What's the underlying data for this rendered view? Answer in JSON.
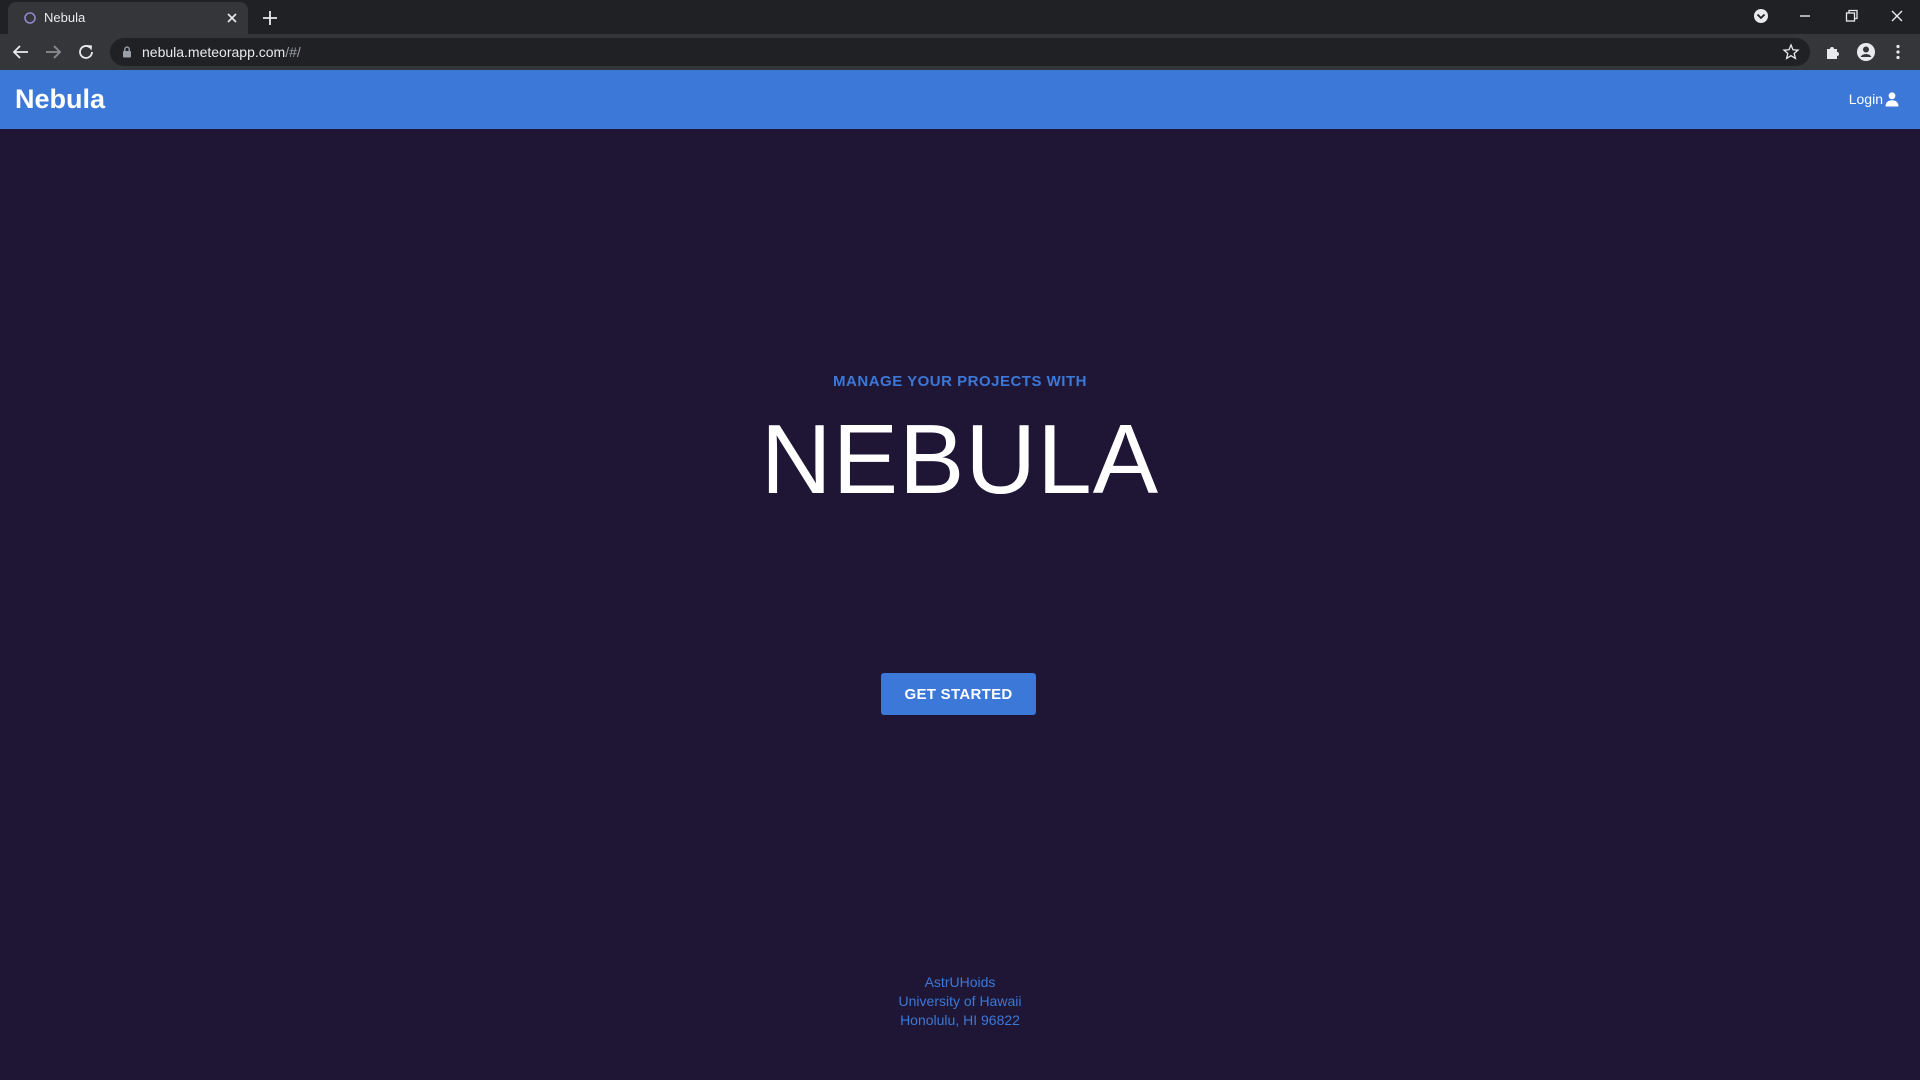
{
  "browser": {
    "tab_title": "Nebula",
    "url_host": "nebula.meteorapp.com",
    "url_path": "/#/"
  },
  "nav": {
    "brand": "Nebula",
    "login_label": "Login"
  },
  "hero": {
    "kicker": "MANAGE YOUR PROJECTS WITH",
    "title": "NEBULA",
    "cta_label": "GET STARTED"
  },
  "footer": {
    "line1": "AstrUHoids",
    "line2": "University of Hawaii",
    "line3": "Honolulu, HI 96822"
  },
  "colors": {
    "page_background": "#1f1635",
    "accent_blue": "#3b78d8",
    "chrome_dark": "#202124",
    "chrome_toolbar": "#35363a"
  },
  "icons": {
    "tab": "nebula-favicon-icon",
    "close": "close-icon",
    "new_tab": "plus-icon",
    "login": "user-icon"
  }
}
